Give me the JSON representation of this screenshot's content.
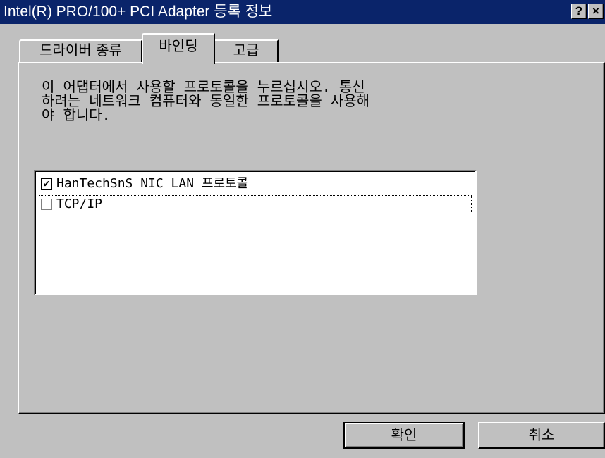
{
  "window": {
    "title": "Intel(R) PRO/100+ PCI Adapter 등록 정보",
    "help_label": "?",
    "close_label": "×"
  },
  "tabs": [
    {
      "label": "드라이버 종류",
      "selected": false
    },
    {
      "label": "바인딩",
      "selected": true
    },
    {
      "label": "고급",
      "selected": false
    }
  ],
  "binding": {
    "description_lines": [
      "이 어댑터에서 사용할 프로토콜을 누르십시오. 통신",
      "하려는 네트워크 컴퓨터와 동일한 프로토콜을 사용해",
      "야 합니다."
    ],
    "protocols": [
      {
        "label": "HanTechSnS NIC LAN 프로토콜",
        "checked": true,
        "mark": "✔"
      },
      {
        "label": "TCP/IP",
        "checked": false,
        "mark": ""
      }
    ]
  },
  "buttons": {
    "ok_label": "확인",
    "cancel_label": "취소"
  }
}
